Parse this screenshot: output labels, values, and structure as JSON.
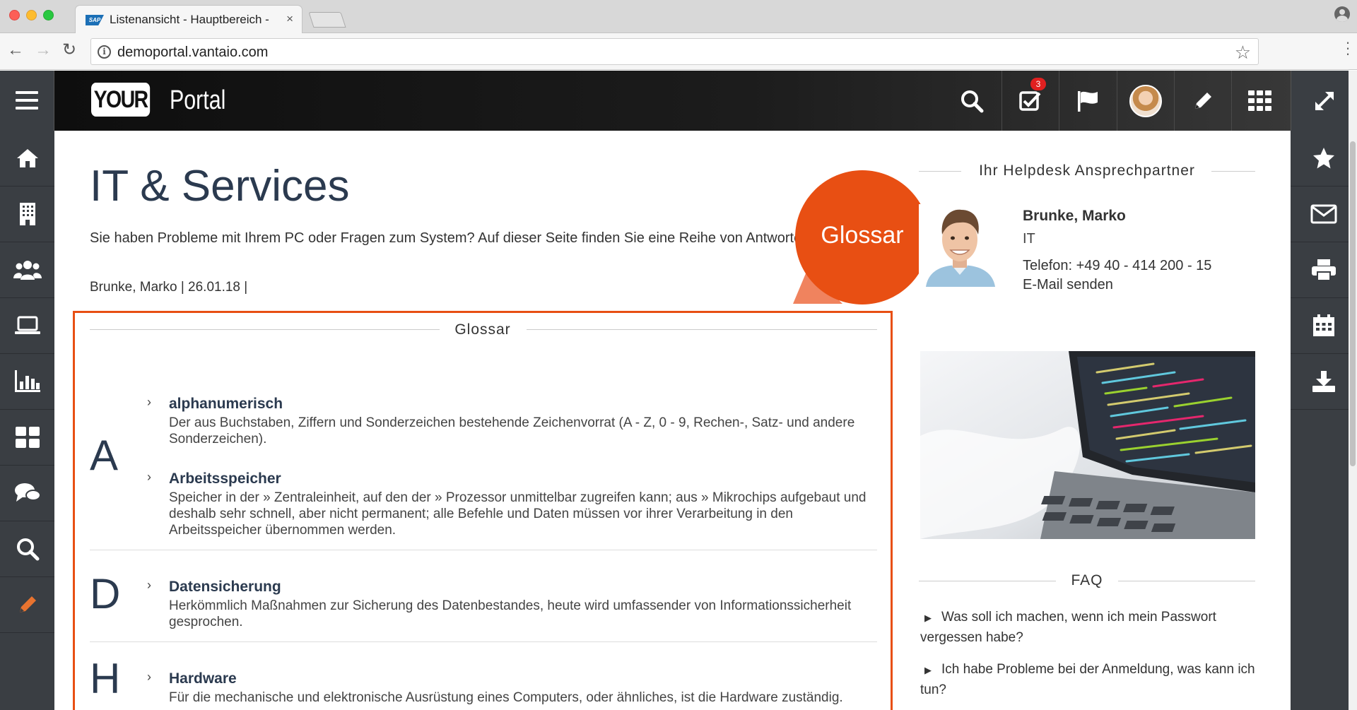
{
  "browser": {
    "tab_title": "Listenansicht - Hauptbereich - ",
    "tab_close": "×",
    "url": "demoportal.vantaio.com",
    "favicon_text": "SAP"
  },
  "header": {
    "logo_your": "YOUR",
    "logo_portal": "Portal",
    "tasks_badge": "3",
    "icons": [
      "menu-icon",
      "search-icon",
      "tasks-icon",
      "flag-icon",
      "avatar",
      "pencil-icon",
      "apps-grid-icon",
      "expand-icon"
    ]
  },
  "left_sidebar": {
    "items": [
      "home-icon",
      "building-icon",
      "users-icon",
      "laptop-icon",
      "chart-icon",
      "dashboard-icon",
      "chat-icon",
      "search-icon",
      "pencil-icon"
    ]
  },
  "right_sidebar": {
    "items": [
      "star-icon",
      "mail-icon",
      "print-icon",
      "calendar-icon",
      "download-icon"
    ]
  },
  "main": {
    "title": "IT & Services",
    "intro": "Sie haben Probleme mit Ihrem PC oder Fragen zum System? Auf dieser Seite finden Sie eine Reihe von  Antworten.",
    "meta": "Brunke, Marko | 26.01.18 |",
    "glossar_badge": "Glossar",
    "glossar": {
      "heading": "Glossar",
      "sections": [
        {
          "letter": "A",
          "entries": [
            {
              "term": "alphanumerisch",
              "desc": "Der aus Buchstaben, Ziffern und Sonderzeichen bestehende Zeichenvorrat (A - Z, 0 - 9, Rechen-, Satz- und andere Sonderzeichen)."
            },
            {
              "term": "Arbeitsspeicher",
              "desc": "Speicher in der » Zentraleinheit, auf den der » Prozessor unmittelbar zugreifen kann; aus » Mikrochips aufgebaut und deshalb sehr schnell, aber nicht permanent; alle Befehle und Daten müssen vor ihrer Verarbeitung in den Arbeitsspeicher übernommen werden."
            }
          ]
        },
        {
          "letter": "D",
          "entries": [
            {
              "term": "Datensicherung",
              "desc": "Herkömmlich Maßnahmen zur Sicherung des Datenbestandes, heute wird umfassender von Informationssicherheit gesprochen."
            }
          ]
        },
        {
          "letter": "H",
          "entries": [
            {
              "term": "Hardware",
              "desc": "Für die mechanische und elektronische Ausrüstung eines Computers, oder ähnliches, ist die Hardware zuständig."
            }
          ]
        }
      ]
    }
  },
  "sidebar_right": {
    "helpdesk_heading": "Ihr Helpdesk Ansprechpartner",
    "contact": {
      "name": "Brunke, Marko",
      "dept": "IT",
      "phone": "Telefon: +49 40 - 414 200 - 15",
      "email": "E-Mail senden"
    },
    "faq_heading": "FAQ",
    "faq": [
      "Was soll ich machen, wenn ich mein Passwort vergessen habe?",
      "Ich habe Probleme bei der Anmeldung, was kann ich tun?"
    ]
  },
  "colors": {
    "accent": "#e84f13",
    "navy": "#2b3a4f",
    "sidebar": "#3a3e43"
  }
}
